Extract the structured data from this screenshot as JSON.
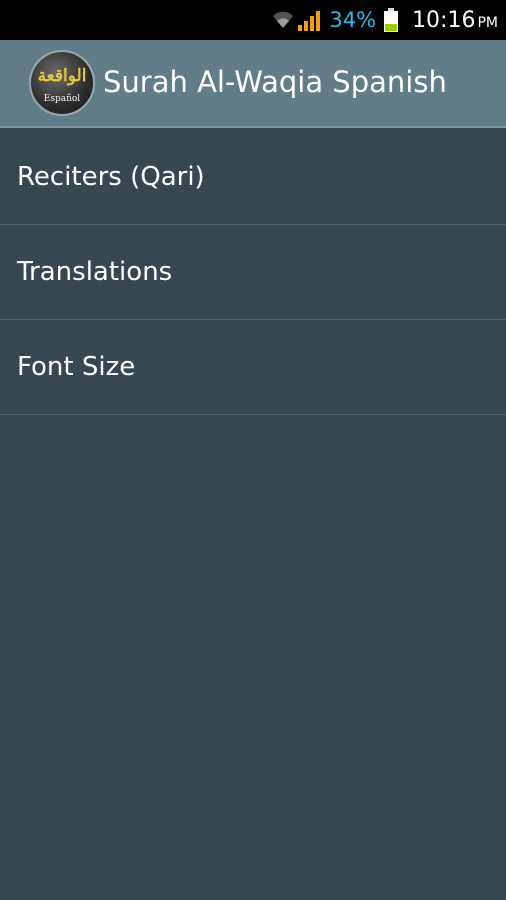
{
  "status_bar": {
    "battery_percent": "34%",
    "time": "10:16",
    "ampm": "PM",
    "icons": [
      "wifi-icon",
      "signal-icon",
      "battery-icon"
    ],
    "colors": {
      "battery_text": "#33b5e5",
      "signal": "#f39c12",
      "battery_fill": "#99cc00"
    }
  },
  "action_bar": {
    "title": "Surah Al-Waqia Spanish",
    "icon": {
      "arabic_text": "الواقعة",
      "caption": "Español"
    },
    "color": "#617d8a"
  },
  "menu": {
    "items": [
      {
        "label": "Reciters (Qari)"
      },
      {
        "label": "Translations"
      },
      {
        "label": "Font Size"
      }
    ]
  },
  "colors": {
    "background": "#37474f"
  }
}
